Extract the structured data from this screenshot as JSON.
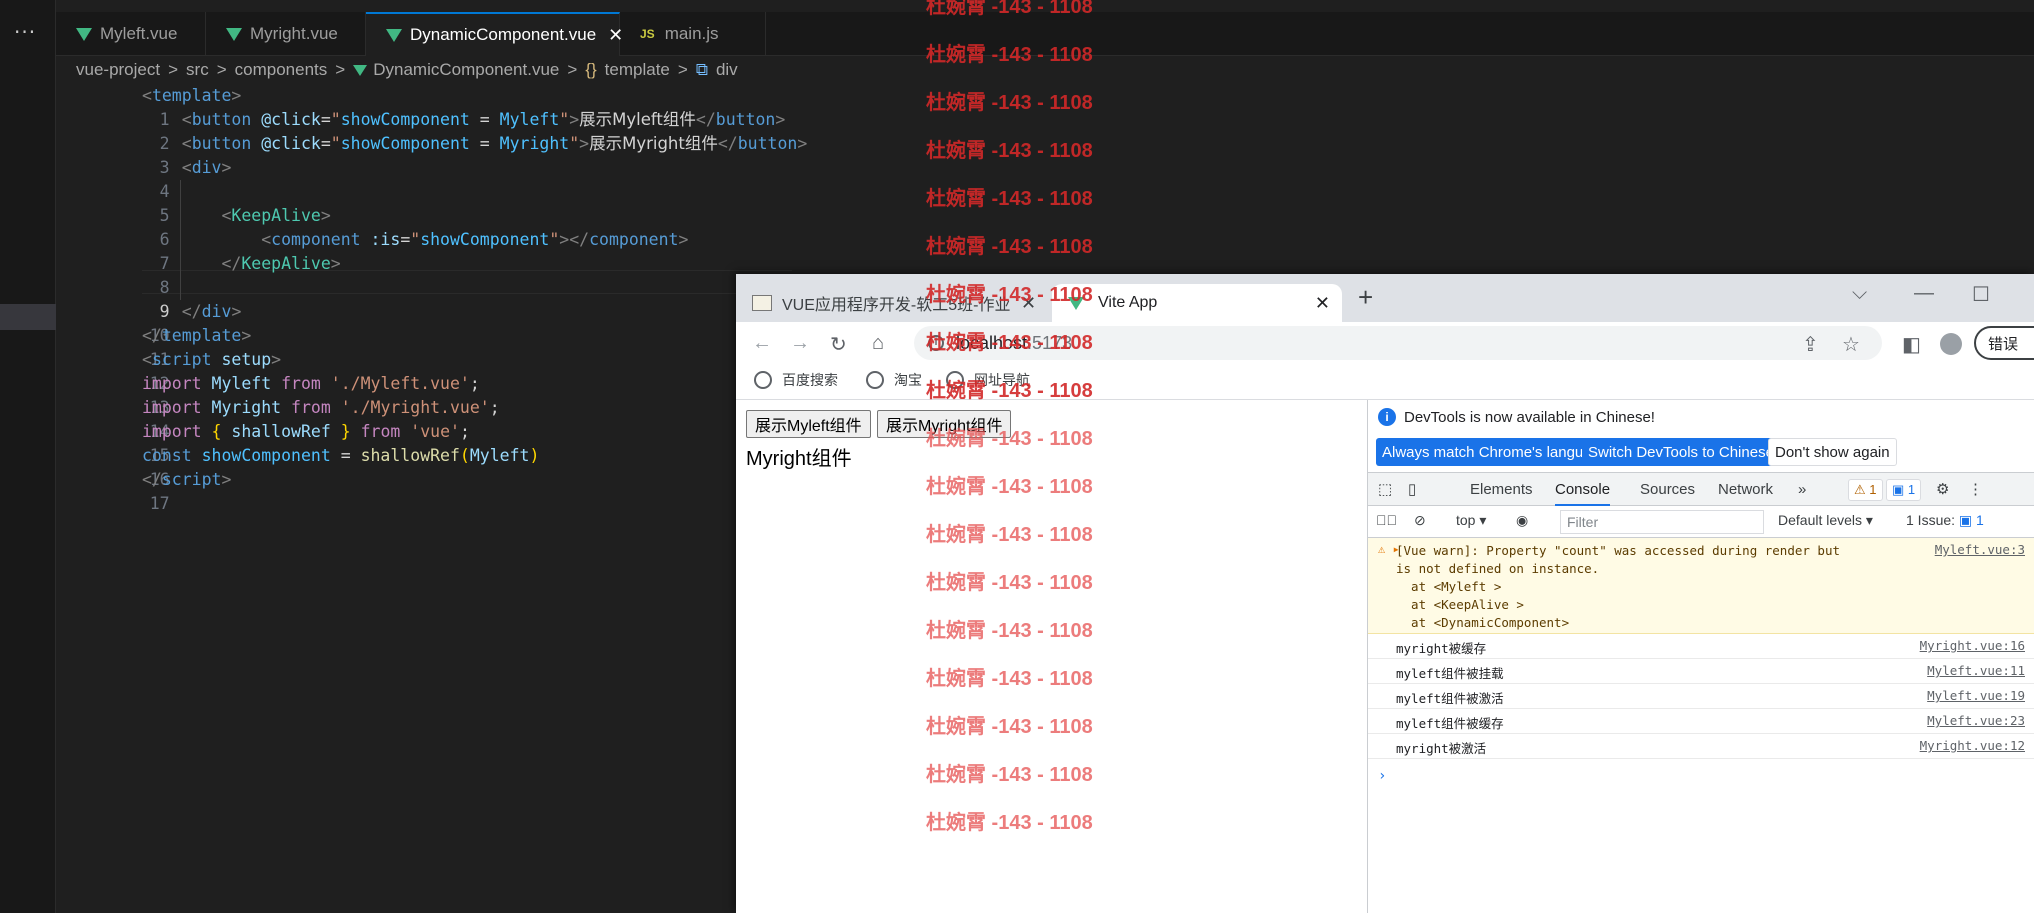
{
  "vscode": {
    "activity_dots": "···",
    "tabs": [
      {
        "label": "Myleft.vue",
        "icon": "vue-icon"
      },
      {
        "label": "Myright.vue",
        "icon": "vue-icon"
      },
      {
        "label": "DynamicComponent.vue",
        "icon": "vue-icon",
        "active": true
      },
      {
        "label": "main.js",
        "icon": "js-icon",
        "icon_text": "JS"
      }
    ],
    "tab_close": "✕",
    "breadcrumb": {
      "project": "vue-project",
      "src": "src",
      "components": "components",
      "file": "DynamicComponent.vue",
      "template_symbol": "{}",
      "template": "template",
      "div": "div",
      "sep": ">"
    },
    "line_numbers": [
      "1",
      "2",
      "3",
      "4",
      "5",
      "6",
      "7",
      "8",
      "9",
      "10",
      "11",
      "12",
      "13",
      "14",
      "15",
      "16",
      "17"
    ],
    "code": {
      "l1_tag": "template",
      "l2_tag": "button",
      "l2_attr": "@click",
      "l2_val_a": "showComponent",
      "l2_val_op": " = ",
      "l2_val_b": "Myleft",
      "l2_text": "展示Myleft组件",
      "l3_tag": "button",
      "l3_attr": "@click",
      "l3_val_a": "showComponent",
      "l3_val_op": " = ",
      "l3_val_b": "Myright",
      "l3_text": "展示Myright组件",
      "l4_tag": "div",
      "l6_tag": "KeepAlive",
      "l7_tag": "component",
      "l7_attr": ":is",
      "l7_val": "showComponent",
      "l8_tag": "KeepAlive",
      "l10_tag": "div",
      "l11_tag": "template",
      "l12_tag": "script",
      "l12_attr": "setup",
      "import": "import",
      "from": "from",
      "l13_name": "Myleft",
      "l13_path": "'./Myleft.vue'",
      "l14_name": "Myright",
      "l14_path": "'./Myright.vue'",
      "l15_name": "shallowRef",
      "l15_path": "'vue'",
      "l16_const": "const",
      "l16_var": "showComponent",
      "l16_fn": "shallowRef",
      "l16_arg": "Myleft",
      "l17_tag": "script"
    }
  },
  "browser": {
    "tab1_title": "VUE应用程序开发-软工5班-作业",
    "tab2_title": "Vite App",
    "close": "✕",
    "new_tab": "+",
    "url_host": "localhost",
    "url_port": ":5173",
    "error_button": "错误",
    "bookmarks": [
      "百度搜索",
      "淘宝",
      "网址导航"
    ],
    "page": {
      "button_left": "展示Myleft组件",
      "button_right": "展示Myright组件",
      "content": "Myright组件"
    }
  },
  "devtools": {
    "notice": "DevTools is now available in Chinese!",
    "btn_match": "Always match Chrome's language",
    "btn_switch": "Switch DevTools to Chinese",
    "btn_dismiss": "Don't show again",
    "tabs": [
      "Elements",
      "Console",
      "Sources",
      "Network"
    ],
    "more_tabs": "»",
    "warn_count": "1",
    "msg_count": "1",
    "context": "top",
    "filter_placeholder": "Filter",
    "levels": "Default levels",
    "issues_label": "1 Issue:",
    "issues_count": "1",
    "warning": {
      "text": "[Vue warn]: Property \"count\" was accessed during render but\nis not defined on instance.\n  at <Myleft >\n  at <KeepAlive >\n  at <DynamicComponent>",
      "source": "Myleft.vue:3"
    },
    "logs": [
      {
        "text": "myright被缓存",
        "source": "Myright.vue:16"
      },
      {
        "text": "myleft组件被挂载",
        "source": "Myleft.vue:11"
      },
      {
        "text": "myleft组件被激活",
        "source": "Myleft.vue:19"
      },
      {
        "text": "myleft组件被缓存",
        "source": "Myleft.vue:23"
      },
      {
        "text": "myright被激活",
        "source": "Myright.vue:12"
      }
    ],
    "prompt": "›"
  },
  "watermark": {
    "text": "杜婉霄 -143 - 1108"
  },
  "colors": {
    "vscode_bg": "#1f1f1f",
    "vue_green": "#41b883",
    "accent_blue": "#1a73e8",
    "watermark_red": "#d22828"
  }
}
